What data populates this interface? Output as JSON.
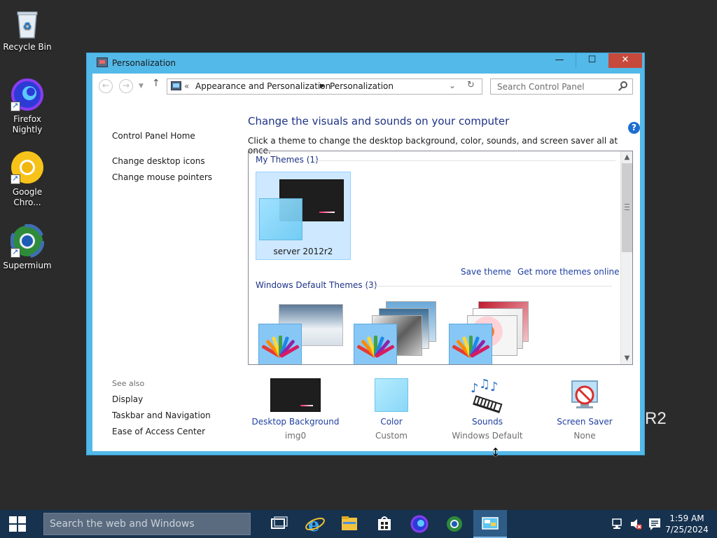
{
  "desktop": {
    "icons": [
      {
        "label": "Recycle Bin"
      },
      {
        "label": "Firefox Nightly"
      },
      {
        "label": "Google Chro..."
      },
      {
        "label": "Supermium"
      }
    ],
    "watermark": "R2"
  },
  "window": {
    "title": "Personalization",
    "buttons": {
      "minimize": "—",
      "maximize": "☐",
      "close": "✕"
    },
    "address": {
      "prefix": "«",
      "crumbs": [
        "Appearance and Personalization",
        "Personalization"
      ]
    },
    "search": {
      "placeholder": "Search Control Panel"
    },
    "help": "?"
  },
  "left_pane": {
    "links": [
      "Control Panel Home",
      "Change desktop icons",
      "Change mouse pointers"
    ],
    "see_also_label": "See also",
    "see_also_links": [
      "Display",
      "Taskbar and Navigation",
      "Ease of Access Center"
    ]
  },
  "main": {
    "title": "Change the visuals and sounds on your computer",
    "description": "Click a theme to change the desktop background, color, sounds, and screen saver all at once.",
    "my_themes_label": "My Themes (1)",
    "my_theme_name": "server 2012r2",
    "save_theme": "Save theme",
    "get_more": "Get more themes online",
    "default_themes_label": "Windows Default Themes (3)"
  },
  "settings": [
    {
      "label": "Desktop Background",
      "value": "img0"
    },
    {
      "label": "Color",
      "value": "Custom"
    },
    {
      "label": "Sounds",
      "value": "Windows Default"
    },
    {
      "label": "Screen Saver",
      "value": "None"
    }
  ],
  "taskbar": {
    "search_placeholder": "Search the web and Windows",
    "time": "1:59 AM",
    "date": "7/25/2024"
  },
  "colors": {
    "window_frame": "#53b9e8",
    "link_blue": "#1e3fa0",
    "heading_blue": "#1e3287",
    "taskbar": "#16324f",
    "close_red": "#c7493b"
  }
}
